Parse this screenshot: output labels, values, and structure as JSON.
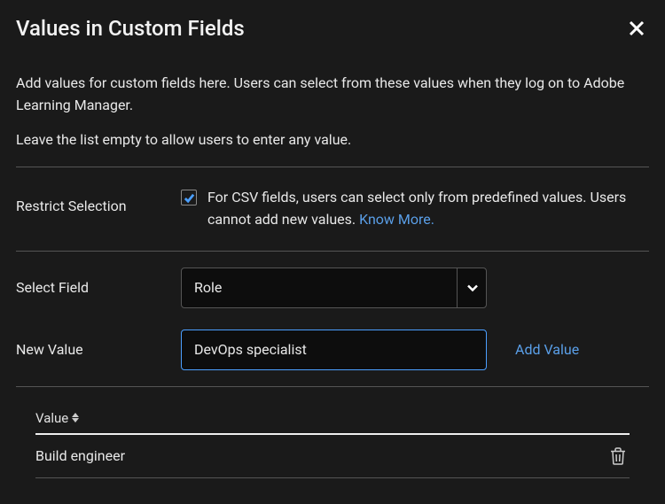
{
  "dialog": {
    "title": "Values in Custom Fields",
    "description1": "Add values for custom fields here. Users can select from these values when they log on to Adobe Learning Manager.",
    "description2": "Leave the list empty to allow users to enter any value."
  },
  "restrict": {
    "label": "Restrict Selection",
    "checked": true,
    "text_part1": "For CSV fields, users can select only from predefined values. Users cannot add new values. ",
    "link_text": "Know More."
  },
  "select_field": {
    "label": "Select Field",
    "value": "Role"
  },
  "new_value": {
    "label": "New Value",
    "value": "DevOps specialist",
    "add_button": "Add Value"
  },
  "table": {
    "column_header": "Value",
    "rows": [
      {
        "value": "Build engineer"
      }
    ]
  }
}
